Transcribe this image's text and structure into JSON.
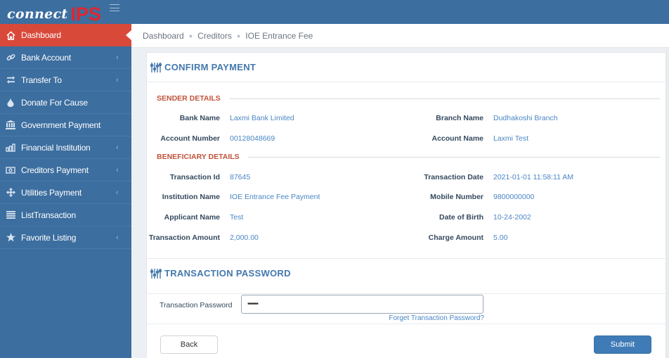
{
  "app": {
    "logo_connect": "connect",
    "logo_ips": "IPS"
  },
  "sidebar": {
    "items": [
      {
        "label": "Dashboard",
        "icon": "home-icon",
        "active": true,
        "has_submenu": false
      },
      {
        "label": "Bank Account",
        "icon": "link-icon",
        "active": false,
        "has_submenu": true
      },
      {
        "label": "Transfer To",
        "icon": "exchange-icon",
        "active": false,
        "has_submenu": true
      },
      {
        "label": "Donate For Cause",
        "icon": "drop-icon",
        "active": false,
        "has_submenu": false
      },
      {
        "label": "Government Payment",
        "icon": "bank-building-icon",
        "active": false,
        "has_submenu": false
      },
      {
        "label": "Financial Institution",
        "icon": "bar-chart-icon",
        "active": false,
        "has_submenu": true
      },
      {
        "label": "Creditors Payment",
        "icon": "money-icon",
        "active": false,
        "has_submenu": true
      },
      {
        "label": "Utilities Payment",
        "icon": "move-arrows-icon",
        "active": false,
        "has_submenu": true
      },
      {
        "label": "ListTransaction",
        "icon": "list-icon",
        "active": false,
        "has_submenu": false
      },
      {
        "label": "Favorite Listing",
        "icon": "star-icon",
        "active": false,
        "has_submenu": true
      }
    ],
    "chevron": "‹"
  },
  "breadcrumb": [
    "Dashboard",
    "Creditors",
    "IOE Entrance Fee"
  ],
  "confirm": {
    "title": "CONFIRM PAYMENT",
    "sender_heading": "SENDER DETAILS",
    "sender_rows": [
      {
        "l1": "Bank Name",
        "v1": "Laxmi Bank Limited",
        "l2": "Branch Name",
        "v2": "Dudhakoshi Branch"
      },
      {
        "l1": "Account Number",
        "v1": "00128048669",
        "l2": "Account Name",
        "v2": "Laxmi Test"
      }
    ],
    "beneficiary_heading": "BENEFICIARY DETAILS",
    "beneficiary_rows": [
      {
        "l1": "Transaction Id",
        "v1": "87645",
        "l2": "Transaction Date",
        "v2": "2021-01-01 11:58:11 AM"
      },
      {
        "l1": "Institution Name",
        "v1": "IOE Entrance Fee Payment",
        "l2": "Mobile Number",
        "v2": "9800000000"
      },
      {
        "l1": "Applicant Name",
        "v1": "Test",
        "l2": "Date of Birth",
        "v2": "10-24-2002"
      },
      {
        "l1": "Transaction Amount",
        "v1": "2,000.00",
        "l2": "Charge Amount",
        "v2": "5.00"
      }
    ]
  },
  "password": {
    "title": "TRANSACTION PASSWORD",
    "label": "Transaction Password",
    "value": "••••••",
    "forget_link": "Forget Transaction Password?"
  },
  "actions": {
    "back": "Back",
    "submit": "Submit"
  },
  "colors": {
    "brand_blue": "#3c6e9f",
    "active_red": "#d9493a",
    "section_blue": "#4478ad",
    "heading_red": "#c0533a",
    "submit_blue": "#3f7bb6"
  }
}
